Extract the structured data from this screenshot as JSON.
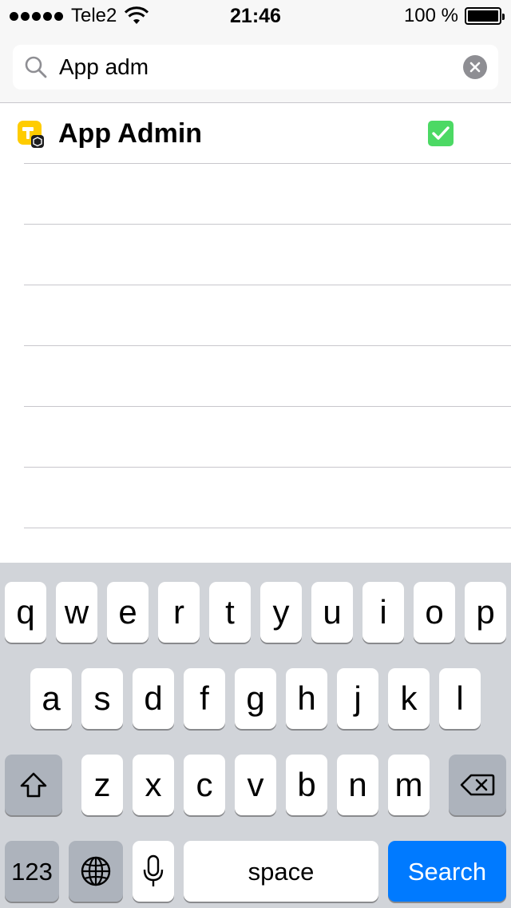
{
  "status_bar": {
    "carrier": "Tele2",
    "time": "21:46",
    "battery": "100 %",
    "battery_level": 1.0
  },
  "search": {
    "value": "App adm",
    "icon": "search-icon",
    "clear_icon": "clear-icon"
  },
  "results": [
    {
      "name": "App Admin",
      "icon": "app-admin-icon",
      "checked": true
    }
  ],
  "keyboard": {
    "row1": [
      "q",
      "w",
      "e",
      "r",
      "t",
      "y",
      "u",
      "i",
      "o",
      "p"
    ],
    "row2": [
      "a",
      "s",
      "d",
      "f",
      "g",
      "h",
      "j",
      "k",
      "l"
    ],
    "row3": [
      "z",
      "x",
      "c",
      "v",
      "b",
      "n",
      "m"
    ],
    "numbers_label": "123",
    "space_label": "space",
    "search_label": "Search",
    "shift_icon": "shift-icon",
    "delete_icon": "delete-icon",
    "globe_icon": "globe-icon",
    "mic_icon": "mic-icon"
  },
  "colors": {
    "accent": "#007aff",
    "check_green": "#4cd964",
    "app_icon_yellow": "#ffcc00"
  }
}
